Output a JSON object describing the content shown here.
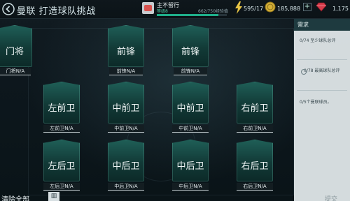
{
  "header": {
    "title": "曼联 打造球队挑战",
    "username": "主不留行",
    "level": "等级8",
    "xp_text": "662/750经验值",
    "xp_progress": 0.883,
    "energy": "595/17",
    "coins": "185,888",
    "plus": "+",
    "gems": "1,175"
  },
  "formation": {
    "goalkeeper": {
      "label": "门将",
      "name": "门将N/A"
    },
    "forwards": [
      {
        "label": "前锋",
        "name": "前锋N/A"
      },
      {
        "label": "前锋",
        "name": "前锋N/A"
      }
    ],
    "midfielders": [
      {
        "label": "左前卫",
        "name": "左前卫N/A"
      },
      {
        "label": "中前卫",
        "name": "中前卫N/A"
      },
      {
        "label": "中前卫",
        "name": "中前卫N/A"
      },
      {
        "label": "右前卫",
        "name": "右前卫N/A"
      }
    ],
    "defenders": [
      {
        "label": "左后卫",
        "name": "左后卫N/A"
      },
      {
        "label": "中后卫",
        "name": "中后卫N/A"
      },
      {
        "label": "中后卫",
        "name": "中后卫N/A"
      },
      {
        "label": "右后卫",
        "name": "右后卫N/A"
      }
    ]
  },
  "requirements": {
    "title": "需求",
    "items": [
      {
        "text": "0/74 至少球队总评"
      },
      {
        "text": "0/78 最高球队总评"
      },
      {
        "text": "0/5个曼联球员。"
      }
    ],
    "submit_label": "提交"
  },
  "footer": {
    "clear_all": "清除全部",
    "bench_icon": "bench-icon"
  },
  "colors": {
    "slot_green": "#1f5f57",
    "accent_teal": "#1fae8a",
    "panel_header": "#1e3a3f"
  }
}
